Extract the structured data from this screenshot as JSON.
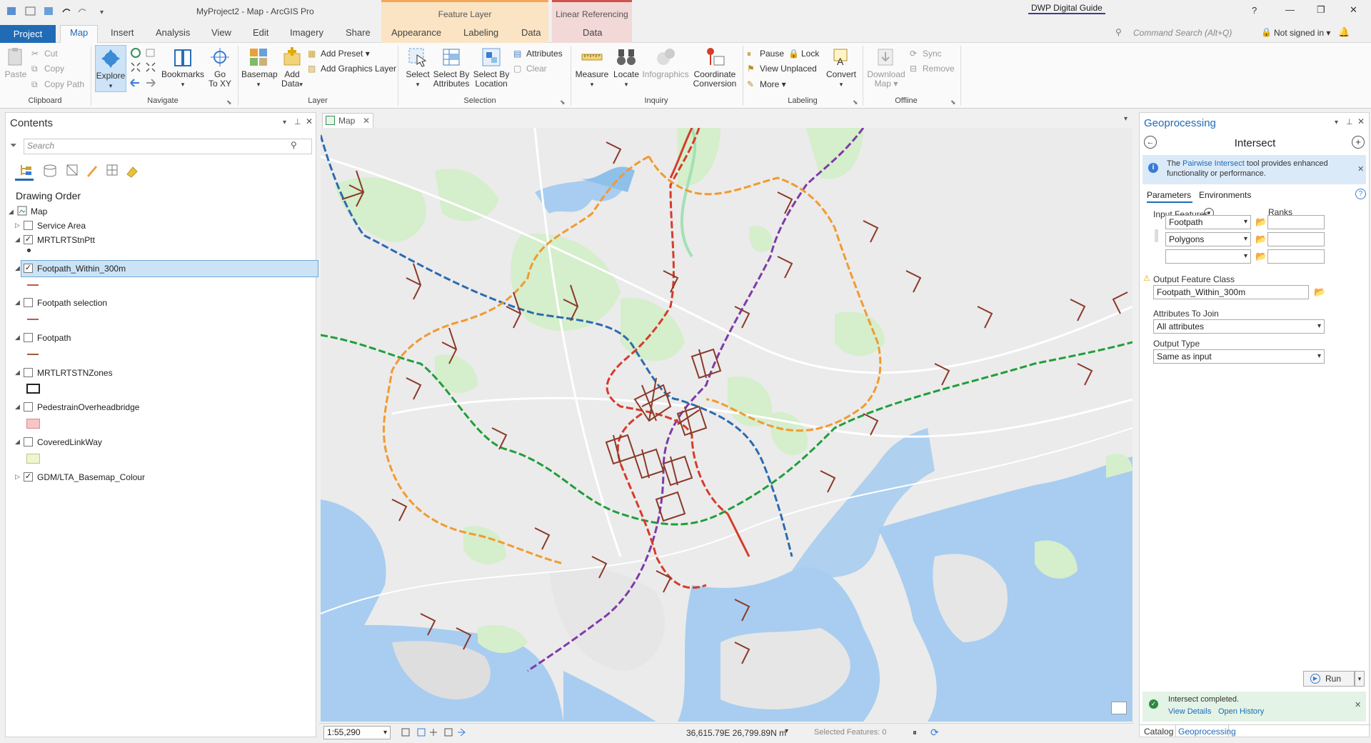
{
  "titlebar": {
    "title": "MyProject2 - Map - ArcGIS Pro",
    "context_feature_layer": "Feature Layer",
    "context_linear_ref": "Linear Referencing",
    "guide_badge": "DWP Digital Guide",
    "help": "?",
    "min": "—",
    "max": "❐",
    "close": "✕"
  },
  "tabs": {
    "project": "Project",
    "items": [
      "Map",
      "Insert",
      "Analysis",
      "View",
      "Edit",
      "Imagery",
      "Share",
      "Appearance",
      "Labeling",
      "Data",
      "Data"
    ],
    "search_placeholder": "Command Search (Alt+Q)",
    "signin": "Not signed in ▾"
  },
  "ribbon": {
    "clipboard": {
      "label": "Clipboard",
      "paste": "Paste",
      "cut": "Cut",
      "copy": "Copy",
      "copy_path": "Copy Path"
    },
    "navigate": {
      "label": "Navigate",
      "explore": "Explore",
      "bookmarks": "Bookmarks",
      "goto": "Go\nTo XY",
      "goto1": "Go",
      "goto2": "To XY"
    },
    "layer": {
      "label": "Layer",
      "basemap": "Basemap",
      "add_data1": "Add",
      "add_data2": "Data",
      "add_preset": "Add Preset",
      "add_graphics": "Add Graphics Layer"
    },
    "selection": {
      "label": "Selection",
      "select": "Select",
      "select_attr1": "Select By",
      "select_attr2": "Attributes",
      "select_loc1": "Select By",
      "select_loc2": "Location",
      "attributes": "Attributes",
      "clear": "Clear"
    },
    "inquiry": {
      "label": "Inquiry",
      "measure": "Measure",
      "locate": "Locate",
      "infographics": "Infographics",
      "coord1": "Coordinate",
      "coord2": "Conversion"
    },
    "labeling": {
      "label": "Labeling",
      "pause": "Pause",
      "lock": "Lock",
      "view_unplaced": "View Unplaced",
      "more": "More",
      "convert": "Convert"
    },
    "offline": {
      "label": "Offline",
      "download1": "Download",
      "download2": "Map",
      "sync": "Sync",
      "remove": "Remove"
    }
  },
  "contents": {
    "title": "Contents",
    "search_placeholder": "Search",
    "drawing_order": "Drawing Order",
    "layers": [
      {
        "name": "Map",
        "checked": true
      },
      {
        "name": "Service Area",
        "checked": false
      },
      {
        "name": "MRTLRTStnPtt",
        "checked": true
      },
      {
        "name": "Footpath_Within_300m",
        "checked": true
      },
      {
        "name": "Footpath selection",
        "checked": false
      },
      {
        "name": "Footpath",
        "checked": false
      },
      {
        "name": "MRTLRTSTNZones",
        "checked": false
      },
      {
        "name": "PedestrainOverheadbridge",
        "checked": false
      },
      {
        "name": "CoveredLinkWay",
        "checked": false
      },
      {
        "name": "GDM/LTA_Basemap_Colour",
        "checked": true
      }
    ]
  },
  "map": {
    "tab": "Map",
    "scale": "1:55,290",
    "coords": "36,615.79E 26,799.89N m",
    "selected_features": "Selected Features: 0"
  },
  "geoprocessing": {
    "title": "Geoprocessing",
    "tool": "Intersect",
    "info_text_1": "The ",
    "info_link": "Pairwise Intersect",
    "info_text_2": " tool provides enhanced functionality or performance.",
    "tab_parameters": "Parameters",
    "tab_environments": "Environments",
    "input_features_label": "Input Features",
    "ranks_label": "Ranks",
    "inputs": [
      "Footpath",
      "Polygons",
      ""
    ],
    "output_label": "Output Feature Class",
    "output_value": "Footpath_Within_300m",
    "attributes_label": "Attributes To Join",
    "attributes_value": "All attributes",
    "output_type_label": "Output Type",
    "output_type_value": "Same as input",
    "run": "Run",
    "completed": "Intersect completed.",
    "view_details": "View Details",
    "open_history": "Open History",
    "bottom_tab_catalog": "Catalog",
    "bottom_tab_gp": "Geoprocessing"
  },
  "colors": {
    "accent": "#1f6bb5",
    "feature_layer_tab": "#f6c889",
    "linear_ref_tab": "#c0392b",
    "map_land": "#ebebeb",
    "map_water": "#a8cdf0",
    "map_green": "#d5eecb",
    "footpath": "#8b3a2a"
  }
}
